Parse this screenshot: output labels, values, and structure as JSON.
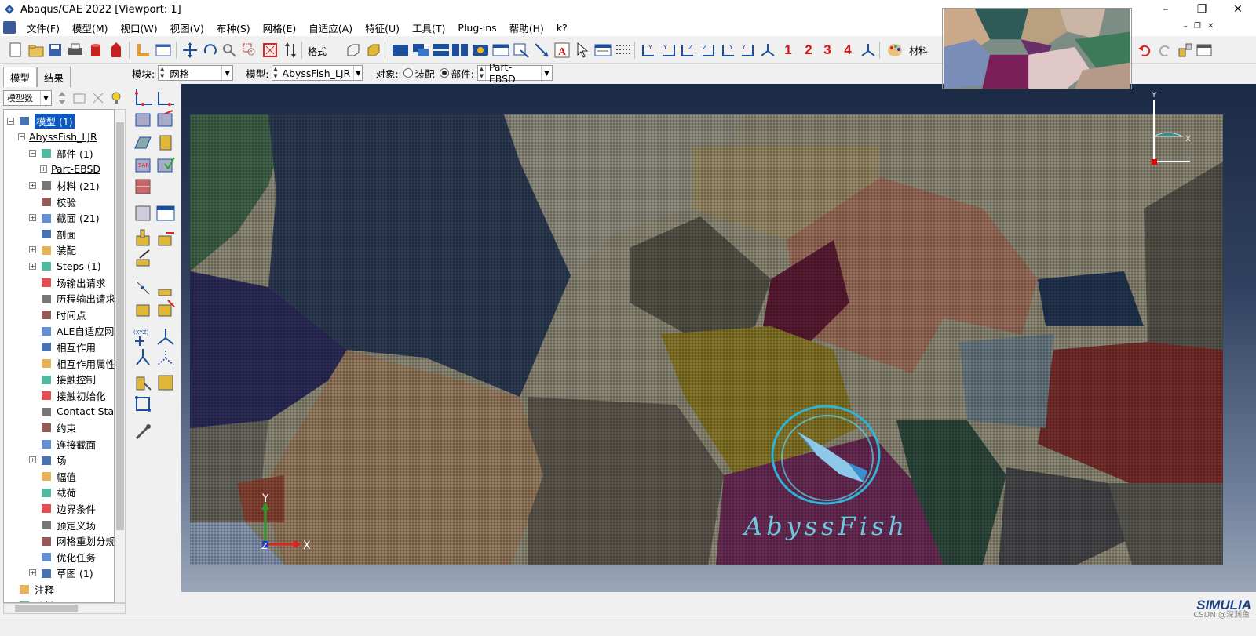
{
  "window": {
    "title": "Abaqus/CAE 2022 [Viewport: 1]",
    "controls": [
      "–",
      "❐",
      "✕"
    ]
  },
  "menu": {
    "items": [
      "文件(F)",
      "模型(M)",
      "视口(W)",
      "视图(V)",
      "布种(S)",
      "网格(E)",
      "自适应(A)",
      "特征(U)",
      "工具(T)",
      "Plug-ins",
      "帮助(H)",
      "k?"
    ]
  },
  "toolbar": {
    "format_label": "格式",
    "numbers": [
      "1",
      "2",
      "3",
      "4"
    ],
    "color_label": "材料"
  },
  "context": {
    "module_label": "模块:",
    "module_value": "网格",
    "model_label": "模型:",
    "model_value": "AbyssFish_LJR",
    "object_label": "对象:",
    "assembly_option": "装配",
    "part_option": "部件:",
    "part_value": "Part-EBSD"
  },
  "left_panel": {
    "tabs": [
      "模型",
      "结果"
    ],
    "tree_filter": "模型数",
    "tree": [
      {
        "label": "模型 (1)",
        "indent": 0,
        "exp": "−",
        "selected": true,
        "icon": "models-icon"
      },
      {
        "label": "AbyssFish_LJR",
        "indent": 1,
        "exp": "−",
        "underline": true,
        "icon": ""
      },
      {
        "label": "部件 (1)",
        "indent": 2,
        "exp": "−",
        "icon": "parts-icon"
      },
      {
        "label": "Part-EBSD",
        "indent": 3,
        "exp": "+",
        "underline": true,
        "icon": ""
      },
      {
        "label": "材料 (21)",
        "indent": 2,
        "exp": "+",
        "icon": "materials-icon"
      },
      {
        "label": "校验",
        "indent": 2,
        "exp": "",
        "icon": "calibration-icon"
      },
      {
        "label": "截面 (21)",
        "indent": 2,
        "exp": "+",
        "icon": "sections-icon"
      },
      {
        "label": "剖面",
        "indent": 2,
        "exp": "",
        "icon": "profiles-icon"
      },
      {
        "label": "装配",
        "indent": 2,
        "exp": "+",
        "icon": "assembly-icon"
      },
      {
        "label": "Steps (1)",
        "indent": 2,
        "exp": "+",
        "icon": "steps-icon"
      },
      {
        "label": "场输出请求",
        "indent": 2,
        "exp": "",
        "icon": "field-output-icon"
      },
      {
        "label": "历程输出请求",
        "indent": 2,
        "exp": "",
        "icon": "history-output-icon"
      },
      {
        "label": "时间点",
        "indent": 2,
        "exp": "",
        "icon": "time-points-icon"
      },
      {
        "label": "ALE自适应网",
        "indent": 2,
        "exp": "",
        "icon": "ale-icon"
      },
      {
        "label": "相互作用",
        "indent": 2,
        "exp": "",
        "icon": "interactions-icon"
      },
      {
        "label": "相互作用属性",
        "indent": 2,
        "exp": "",
        "icon": "interaction-props-icon"
      },
      {
        "label": "接触控制",
        "indent": 2,
        "exp": "",
        "icon": "contact-controls-icon"
      },
      {
        "label": "接触初始化",
        "indent": 2,
        "exp": "",
        "icon": "contact-init-icon"
      },
      {
        "label": "Contact Stab",
        "indent": 2,
        "exp": "",
        "icon": "contact-stab-icon"
      },
      {
        "label": "约束",
        "indent": 2,
        "exp": "",
        "icon": "constraints-icon"
      },
      {
        "label": "连接截面",
        "indent": 2,
        "exp": "",
        "icon": "connector-sections-icon"
      },
      {
        "label": "场",
        "indent": 2,
        "exp": "+",
        "icon": "fields-icon"
      },
      {
        "label": "幅值",
        "indent": 2,
        "exp": "",
        "icon": "amplitudes-icon"
      },
      {
        "label": "载荷",
        "indent": 2,
        "exp": "",
        "icon": "loads-icon"
      },
      {
        "label": "边界条件",
        "indent": 2,
        "exp": "",
        "icon": "bcs-icon"
      },
      {
        "label": "预定义场",
        "indent": 2,
        "exp": "",
        "icon": "predefined-fields-icon"
      },
      {
        "label": "网格重划分规",
        "indent": 2,
        "exp": "",
        "icon": "remeshing-icon"
      },
      {
        "label": "优化任务",
        "indent": 2,
        "exp": "",
        "icon": "optimization-icon"
      },
      {
        "label": "草图 (1)",
        "indent": 2,
        "exp": "+",
        "icon": "sketches-icon"
      },
      {
        "label": "注释",
        "indent": 0,
        "exp": "",
        "icon": "annotations-icon"
      },
      {
        "label": "分析",
        "indent": 0,
        "exp": "",
        "icon": "analysis-icon"
      }
    ]
  },
  "viewport": {
    "logo_text": "AbyssFish",
    "triad_y": "Y",
    "triad_x": "X",
    "triad_z": "Z",
    "view_triad_y": "Y",
    "view_triad_x": "X",
    "brand": "SIMULIA",
    "watermark": "CSDN @深渊鱼"
  },
  "colors": {
    "accent": "#0a58c2",
    "viewport_top": "#1b2a45",
    "viewport_bottom": "#9aa6b8"
  }
}
